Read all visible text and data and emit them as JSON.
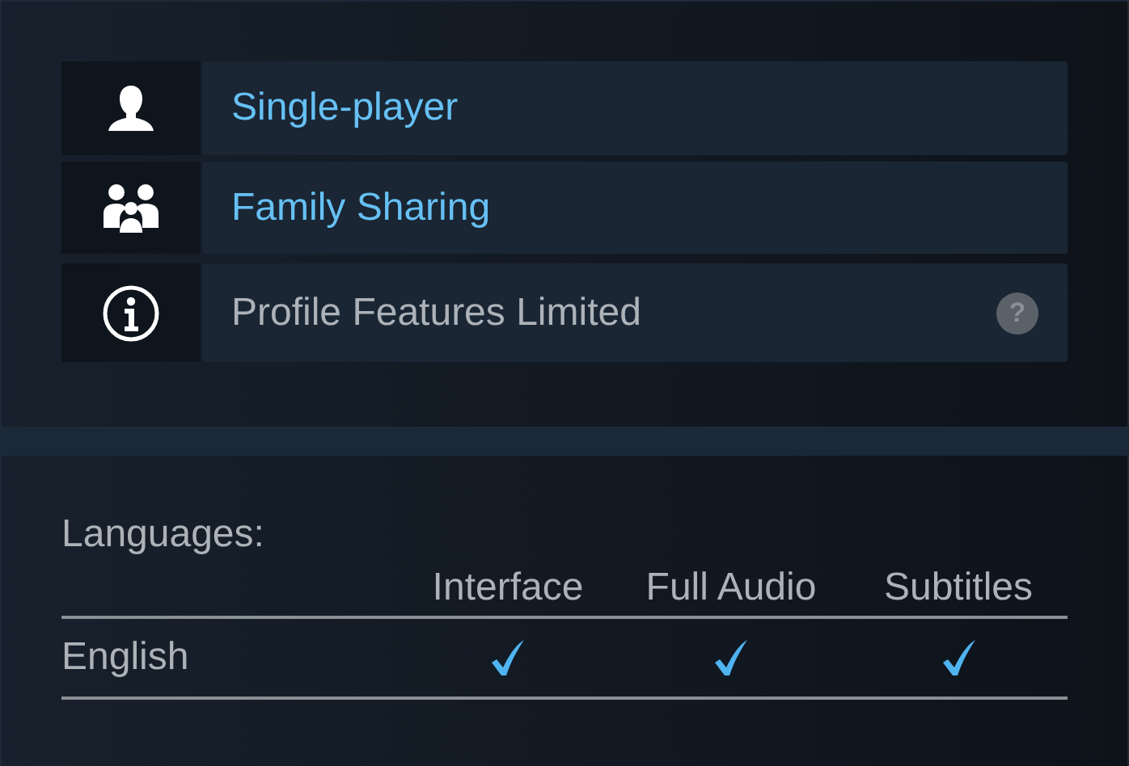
{
  "features": [
    {
      "kind": "link",
      "label": "Single-player"
    },
    {
      "kind": "link",
      "label": "Family Sharing"
    },
    {
      "kind": "info",
      "label": "Profile Features Limited",
      "help": "?"
    }
  ],
  "languages": {
    "title": "Languages:",
    "columns": [
      "Interface",
      "Full Audio",
      "Subtitles"
    ],
    "rows": [
      {
        "name": "English",
        "checks": [
          {
            "checked": true
          },
          {
            "checked": true
          },
          {
            "checked": true
          }
        ]
      }
    ]
  }
}
